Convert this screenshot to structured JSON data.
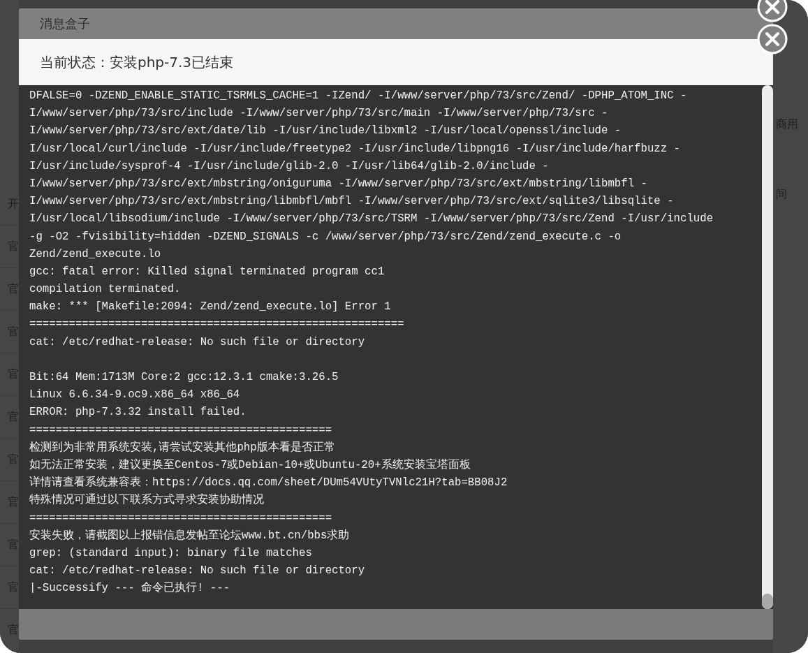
{
  "background_page": {
    "left_column": [
      "开",
      "官",
      "官",
      "官",
      "官",
      "官",
      "官",
      "官",
      "官",
      "官",
      "官"
    ],
    "right_texts": [
      "商用",
      "间"
    ]
  },
  "dialog": {
    "title": "消息盒子",
    "status": "当前状态：安装php-7.3已结束",
    "log_blocks": [
      [
        "DFALSE=0 -DZEND_ENABLE_STATIC_TSRMLS_CACHE=1 -IZend/ -I/www/server/php/73/src/Zend/ -DPHP_ATOM_INC -",
        "I/www/server/php/73/src/include -I/www/server/php/73/src/main -I/www/server/php/73/src -",
        "I/www/server/php/73/src/ext/date/lib -I/usr/include/libxml2 -I/usr/local/openssl/include -",
        "I/usr/local/curl/include -I/usr/include/freetype2 -I/usr/include/libpng16 -I/usr/include/harfbuzz -",
        "I/usr/include/sysprof-4 -I/usr/include/glib-2.0 -I/usr/lib64/glib-2.0/include -",
        "I/www/server/php/73/src/ext/mbstring/oniguruma -I/www/server/php/73/src/ext/mbstring/libmbfl -",
        "I/www/server/php/73/src/ext/mbstring/libmbfl/mbfl -I/www/server/php/73/src/ext/sqlite3/libsqlite -",
        "I/usr/local/libsodium/include -I/www/server/php/73/src/TSRM -I/www/server/php/73/src/Zend -I/usr/include",
        "-g -O2 -fvisibility=hidden -DZEND_SIGNALS -c /www/server/php/73/src/Zend/zend_execute.c -o",
        "Zend/zend_execute.lo",
        "gcc: fatal error: Killed signal terminated program cc1",
        "compilation terminated.",
        "make: *** [Makefile:2094: Zend/zend_execute.lo] Error 1",
        "=========================================================",
        "cat: /etc/redhat-release: No such file or directory"
      ],
      [
        "Bit:64 Mem:1713M Core:2 gcc:12.3.1 cmake:3.26.5",
        "Linux 6.6.34-9.oc9.x86_64 x86_64",
        "ERROR: php-7.3.32 install failed.",
        "==============================================",
        "检测到为非常用系统安装,请尝试安装其他php版本看是否正常",
        "如无法正常安装，建议更换至Centos-7或Debian-10+或Ubuntu-20+系统安装宝塔面板",
        "详情请查看系统兼容表：https://docs.qq.com/sheet/DUm54VUtyTVNlc21H?tab=BB08J2",
        "特殊情况可通过以下联系方式寻求安装协助情况",
        "==============================================",
        "安装失败，请截图以上报错信息发帖至论坛www.bt.cn/bbs求助",
        "grep: (standard input): binary file matches",
        "cat: /etc/redhat-release: No such file or directory",
        "|-Successify --- 命令已执行! ---"
      ]
    ]
  }
}
